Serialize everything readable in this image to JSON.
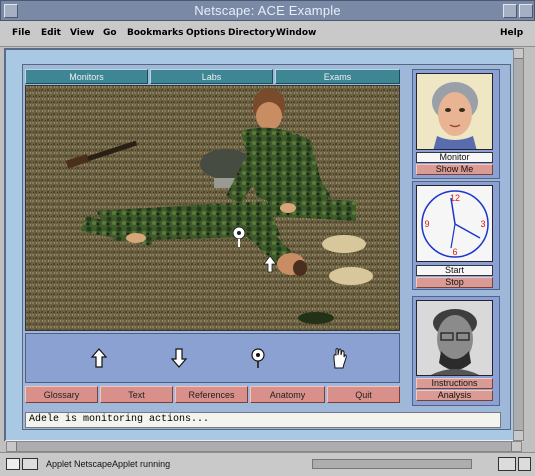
{
  "window": {
    "title": "Netscape: ACE Example"
  },
  "menubar": {
    "items": [
      "File",
      "Edit",
      "View",
      "Go",
      "Bookmarks",
      "Options",
      "Directory",
      "Window"
    ],
    "help": "Help"
  },
  "tabs": [
    "Monitors",
    "Labs",
    "Exams"
  ],
  "toolbar": {
    "tools": [
      "up-arrow-icon",
      "down-arrow-icon",
      "stethoscope-icon",
      "hand-icon"
    ]
  },
  "bottom_buttons": [
    "Glossary",
    "Text",
    "References",
    "Anatomy",
    "Quit"
  ],
  "status": {
    "text": "Adele is monitoring actions..."
  },
  "right": {
    "monitor": {
      "label": "Monitor",
      "button": "Show Me"
    },
    "clock": {
      "label": "Start",
      "button": "Stop",
      "numbers": [
        "12",
        "3",
        "6",
        "9"
      ]
    },
    "instructor": {
      "label": "Instructions",
      "button": "Analysis"
    }
  },
  "bottombar": {
    "status_text": "Applet NetscapeApplet running"
  },
  "colors": {
    "accent": "#3f8694",
    "panel": "#8aa1d2",
    "button": "#d98f8a",
    "background": "#a9c8e3"
  }
}
